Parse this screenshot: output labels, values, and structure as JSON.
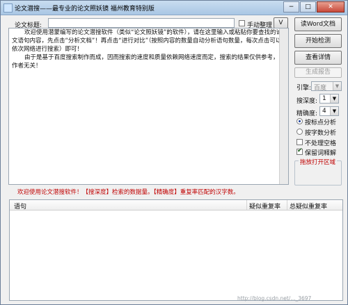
{
  "window": {
    "title": "论文潜搜——最专业的论文照妖镜 福州教育特别版",
    "minimize": "−",
    "maximize": "□",
    "close": "✕"
  },
  "title_row": {
    "label": "论文标题:",
    "title_value": "",
    "manual_label": "手动整理",
    "manual_checked": false,
    "v_button": "V"
  },
  "content": {
    "paragraphs": [
      "欢迎使用潜蒙编写的论文潜搜软件（类似“论文照妖镜”的软件），请在这里输入或粘贴你要查找的论文语句内容，先点击“分析文档”！再点击“进行对比”（按照内容的数量自动分析语句数量，每次点击可以依次网络进行搜索）即可！",
      "由于是基于百度搜索制作而成，因而搜索的速度和质量依赖网络速度而定，搜索的结果仅供参考，与作者无关！"
    ]
  },
  "side": {
    "read_word": "读Word文档",
    "start_check": "开始检测",
    "view_detail": "查看详情",
    "gen_report": "生成报告",
    "engine_label": "引擎:",
    "engine_value": "百度",
    "depth_label": "搜深度:",
    "depth_value": "1",
    "precision_label": "精确度:",
    "precision_value": "4",
    "radio_punct": "按标点分析",
    "radio_chars": "按字数分析",
    "radio_selected": "punct",
    "chk_space": "不处理空格",
    "chk_space_on": false,
    "chk_keep": "保留词释解",
    "chk_keep_on": true,
    "drag_area": "拖放打开区域"
  },
  "status": "欢迎使用论文潜搜软件！【搜深度】检索的数据量。【精确度】重复率匹配的汉字数。",
  "grid": {
    "columns": [
      "语句",
      "疑似重复率",
      "总疑似重复率"
    ]
  },
  "watermark": "http://blog.csdn.net/..._3697"
}
